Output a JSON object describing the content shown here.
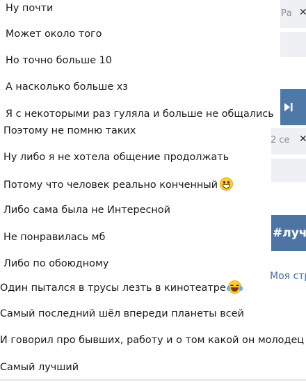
{
  "messages": [
    {
      "text": "Ну почти"
    },
    {
      "text": "Может около того"
    },
    {
      "text": "Но точно больше 10"
    },
    {
      "text": "А насколько больше хз"
    },
    {
      "text": "Я с некоторыми раз гуляла и больше не общались"
    },
    {
      "text": "Поэтому не помню таких"
    },
    {
      "text": "Ну либо я не хотела общение продолжать"
    },
    {
      "text": "Потому что человек реально конченный",
      "emoji": "grinning-face"
    },
    {
      "text": "Либо сама была не Интересной"
    },
    {
      "text": "Не понравилась мб"
    },
    {
      "text": "Либо по обоюдному"
    },
    {
      "text": "Один пытался в трусы лезть в кинотеатре",
      "emoji": "face-with-tears-of-joy"
    },
    {
      "text": "Самый последний шёл впереди планеты всей"
    },
    {
      "text": "И говорил про бывших, работу и о том какой он молодец"
    },
    {
      "text": "Самый лучший"
    }
  ],
  "background_ui": {
    "fragment_1_text": "Ра",
    "fragment_2_text": "2 се",
    "banner_text": "#лучш",
    "link_text": "Моя стр",
    "close_icon": "close-icon",
    "play_icon": "skip-forward-icon",
    "accent_color": "#4d74a3",
    "link_color": "#3f6ea2"
  }
}
